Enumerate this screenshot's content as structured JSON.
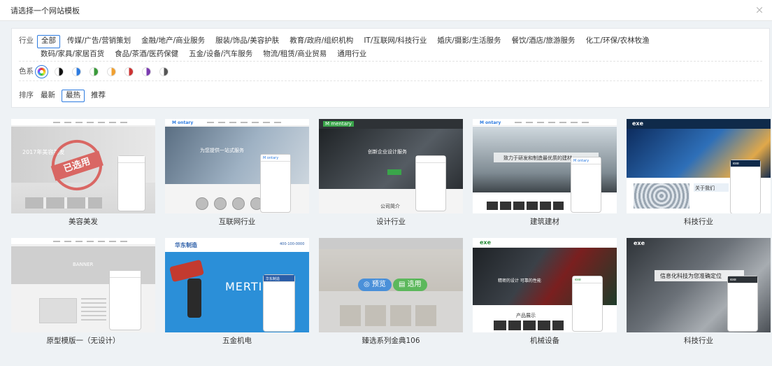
{
  "dialog": {
    "title": "请选择一个网站模板",
    "close_symbol": "×"
  },
  "filters": {
    "industry": {
      "label": "行业",
      "options": [
        "全部",
        "传媒/广告/营销策划",
        "金融/地产/商业服务",
        "服装/饰品/美容护肤",
        "教育/政府/组织机构",
        "IT/互联网/科技行业",
        "婚庆/摄影/生活服务",
        "餐饮/酒店/旅游服务",
        "化工/环保/农林牧渔",
        "数码/家具/家居百货",
        "食品/茶酒/医药保健",
        "五金/设备/汽车服务",
        "物流/租赁/商业贸易",
        "通用行业"
      ],
      "selected": "全部"
    },
    "color": {
      "label": "色系",
      "swatches": [
        "rainbow",
        "#111111",
        "#2d7be0",
        "#3a9a3a",
        "#f0a030",
        "#cc3333",
        "#7a3ab0",
        "#555555"
      ],
      "selected_index": 0
    },
    "sort": {
      "label": "排序",
      "options": [
        "最新",
        "最热",
        "推荐"
      ],
      "selected": "最热"
    }
  },
  "templates": [
    {
      "name": "美容美发",
      "banner_text": "2017年美容美发",
      "stamp": "已选用"
    },
    {
      "name": "互联网行业",
      "logo": "M ontary",
      "banner_text": "为您提供一站式服务"
    },
    {
      "name": "设计行业",
      "logo": "M mentary",
      "banner_text": "创新企业设计服务",
      "section": "公司简介"
    },
    {
      "name": "建筑建材",
      "logo": "M ontary",
      "banner_text": "致力于研发和制造最优质的建材"
    },
    {
      "name": "科技行业",
      "logo": "exe",
      "section": "关于我们"
    },
    {
      "name": "原型模版一（无设计）",
      "banner_text": "BANNER"
    },
    {
      "name": "五金机电",
      "logo": "华东制造",
      "banner_text": "MERTI",
      "phone": "400-100-0000"
    },
    {
      "name": "臻选系列金典106",
      "hover": {
        "preview": "预览",
        "select": "选用"
      }
    },
    {
      "name": "机械设备",
      "logo": "exe",
      "banner_text": "精密的设计 可靠的性能",
      "section": "产品展示"
    },
    {
      "name": "科技行业",
      "logo": "exe",
      "banner_text": "信息化科技为您准确定位"
    }
  ]
}
